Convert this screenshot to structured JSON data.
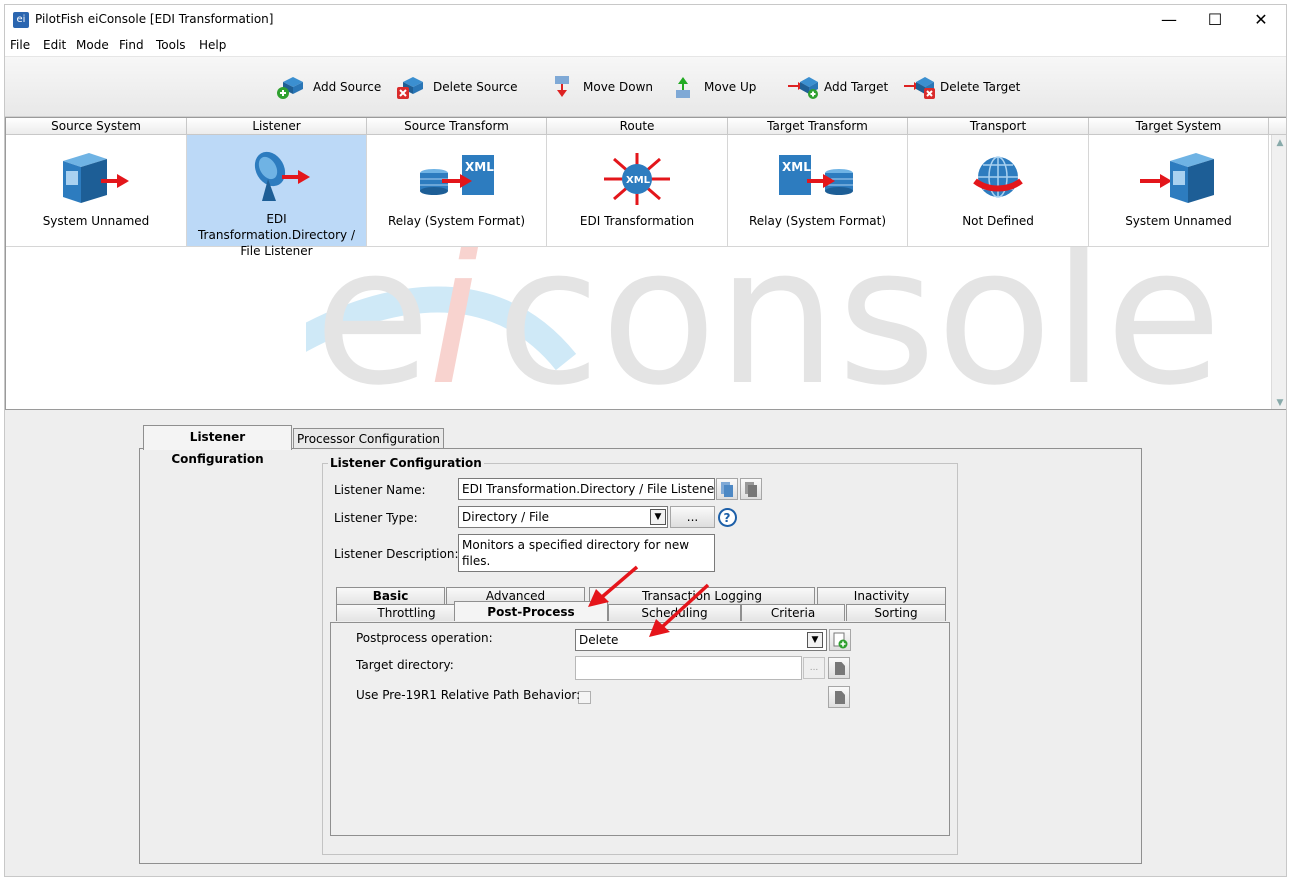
{
  "window": {
    "title": "PilotFish eiConsole [EDI Transformation]",
    "controls": {
      "minimize": "—",
      "maximize": "☐",
      "close": "✕"
    }
  },
  "menu": [
    "File",
    "Edit",
    "Mode",
    "Find",
    "Tools",
    "Help"
  ],
  "toolbar": {
    "add_source": "Add Source",
    "delete_source": "Delete Source",
    "move_down": "Move Down",
    "move_up": "Move Up",
    "add_target": "Add Target",
    "delete_target": "Delete Target"
  },
  "stages": [
    {
      "header": "Source System",
      "label": "System Unnamed",
      "icon": "source-system-icon"
    },
    {
      "header": "Listener",
      "label": "EDI Transformation.Directory / File Listener",
      "icon": "listener-satellite-icon",
      "selected": true
    },
    {
      "header": "Source Transform",
      "label": "Relay (System Format)",
      "icon": "source-transform-icon"
    },
    {
      "header": "Route",
      "label": "EDI Transformation",
      "icon": "route-xml-icon"
    },
    {
      "header": "Target Transform",
      "label": "Relay (System Format)",
      "icon": "target-transform-icon"
    },
    {
      "header": "Transport",
      "label": "Not Defined",
      "icon": "transport-globe-icon"
    },
    {
      "header": "Target System",
      "label": "System Unnamed",
      "icon": "target-system-icon"
    }
  ],
  "watermark": {
    "left": "e",
    "middle": "i",
    "right": "console"
  },
  "main_tabs": [
    {
      "label": "Listener Configuration",
      "active": true
    },
    {
      "label": "Processor Configuration",
      "active": false
    }
  ],
  "listener_config": {
    "group_title": "Listener Configuration",
    "name_label": "Listener Name:",
    "name_value": "EDI Transformation.Directory / File Listener",
    "type_label": "Listener Type:",
    "type_value": "Directory / File",
    "type_more": "...",
    "desc_label": "Listener Description:",
    "desc_value": "Monitors a specified directory for new files."
  },
  "sub_tabs_row1": [
    "Basic",
    "Advanced",
    "Transaction Logging",
    "Inactivity"
  ],
  "sub_tabs_row2": [
    "Throttling",
    "Post-Process",
    "Scheduling",
    "Criteria",
    "Sorting"
  ],
  "active_sub_tab": "Post-Process",
  "post_process": {
    "operation_label": "Postprocess operation:",
    "operation_value": "Delete",
    "target_dir_label": "Target directory:",
    "target_dir_value": "",
    "browse": "...",
    "pre19_label": "Use Pre-19R1 Relative Path Behavior:",
    "pre19_checked": false
  },
  "colors": {
    "selected_cell": "#bcd9f7",
    "annotation_arrow": "#e5151b",
    "icon_blue": "#2f7fc0"
  }
}
